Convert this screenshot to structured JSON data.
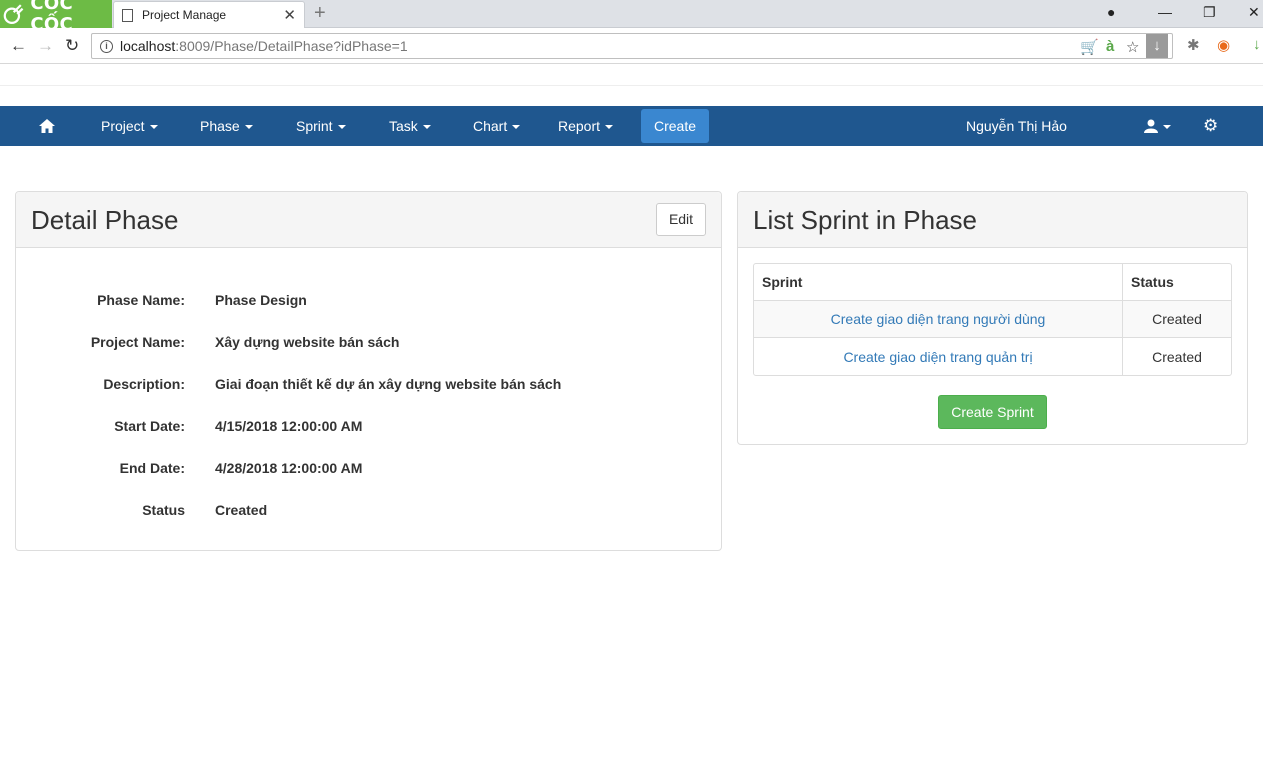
{
  "browser": {
    "brand_name": "CỐC CỐC",
    "tab_title": "Project Manage",
    "url_host": "localhost",
    "url_path": ":8009/Phase/DetailPhase?idPhase=1"
  },
  "navbar": {
    "items": [
      {
        "label": "Project"
      },
      {
        "label": "Phase"
      },
      {
        "label": "Sprint"
      },
      {
        "label": "Task"
      },
      {
        "label": "Chart"
      },
      {
        "label": "Report"
      }
    ],
    "create_label": "Create",
    "user_name": "Nguyễn Thị Hảo"
  },
  "detail_panel": {
    "title": "Detail Phase",
    "edit_label": "Edit",
    "fields": [
      {
        "label": "Phase Name:",
        "value": "Phase Design"
      },
      {
        "label": "Project Name:",
        "value": "Xây dựng website bán sách"
      },
      {
        "label": "Description:",
        "value": "Giai đoạn thiết kế dự án xây dựng website bán sách"
      },
      {
        "label": "Start Date:",
        "value": "4/15/2018 12:00:00 AM"
      },
      {
        "label": "End Date:",
        "value": "4/28/2018 12:00:00 AM"
      },
      {
        "label": "Status",
        "value": "Created"
      }
    ]
  },
  "sprint_panel": {
    "title": "List Sprint in Phase",
    "columns": [
      "Sprint",
      "Status"
    ],
    "rows": [
      {
        "sprint": "Create giao diện trang người dùng",
        "status": "Created"
      },
      {
        "sprint": "Create giao diện trang quản trị",
        "status": "Created"
      }
    ],
    "create_label": "Create Sprint"
  },
  "colors": {
    "navbar_bg": "#1f578f",
    "create_btn": "#3a87d0",
    "create_sprint_btn": "#5cb85c",
    "link": "#337ab7",
    "brand_green": "#6dbb45"
  }
}
